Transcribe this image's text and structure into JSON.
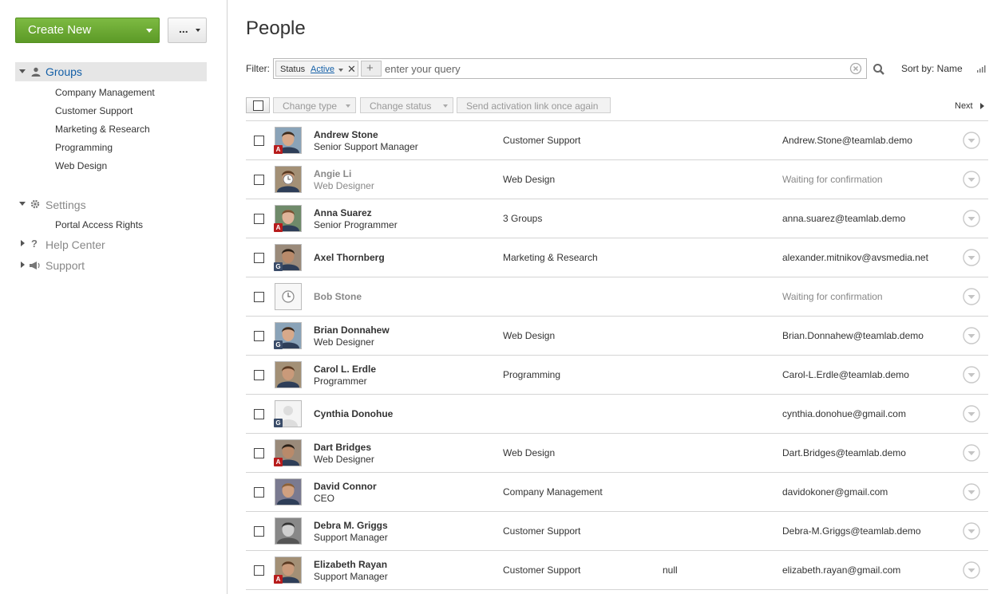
{
  "sidebar": {
    "create_label": "Create New",
    "more_label": "...",
    "groups_label": "Groups",
    "group_items": [
      "Company Management",
      "Customer Support",
      "Marketing & Research",
      "Programming",
      "Web Design"
    ],
    "settings_label": "Settings",
    "settings_items": [
      "Portal Access Rights"
    ],
    "help_label": "Help Center",
    "support_label": "Support"
  },
  "header": {
    "title": "People"
  },
  "filter": {
    "label": "Filter:",
    "chip_name": "Status",
    "chip_value": "Active",
    "chip_remove": "✕",
    "add_symbol": "+",
    "placeholder": "enter your query",
    "sort_label": "Sort by: Name"
  },
  "toolbar": {
    "change_type": "Change type",
    "change_status": "Change status",
    "send_activation": "Send activation link once again",
    "next": "Next"
  },
  "colors": {
    "accent_green": "#6aaa33",
    "link_blue": "#135fa7",
    "admin_badge": "#b71c1c",
    "guest_badge": "#3a4c69"
  },
  "people": [
    {
      "name": "Andrew Stone",
      "title": "Senior Support Manager",
      "dept": "Customer Support",
      "extra": "",
      "email": "Andrew.Stone@teamlab.demo",
      "badge": "A",
      "pending": false,
      "avatar": "photo"
    },
    {
      "name": "Angie Li",
      "title": "Web Designer",
      "dept": "Web Design",
      "extra": "",
      "email": "Waiting for confirmation",
      "badge": "",
      "pending": true,
      "avatar": "photo-clock"
    },
    {
      "name": "Anna Suarez",
      "title": "Senior Programmer",
      "dept": "3 Groups",
      "extra": "",
      "email": "anna.suarez@teamlab.demo",
      "badge": "A",
      "pending": false,
      "avatar": "photo"
    },
    {
      "name": "Axel Thornberg",
      "title": "",
      "dept": "Marketing & Research",
      "extra": "",
      "email": "alexander.mitnikov@avsmedia.net",
      "badge": "G",
      "pending": false,
      "avatar": "photo"
    },
    {
      "name": "Bob Stone",
      "title": "",
      "dept": "",
      "extra": "",
      "email": "Waiting for confirmation",
      "badge": "",
      "pending": true,
      "avatar": "clock"
    },
    {
      "name": "Brian Donnahew",
      "title": "Web Designer",
      "dept": "Web Design",
      "extra": "",
      "email": "Brian.Donnahew@teamlab.demo",
      "badge": "G",
      "pending": false,
      "avatar": "photo"
    },
    {
      "name": "Carol L. Erdle",
      "title": "Programmer",
      "dept": "Programming",
      "extra": "",
      "email": "Carol-L.Erdle@teamlab.demo",
      "badge": "",
      "pending": false,
      "avatar": "photo"
    },
    {
      "name": "Cynthia Donohue",
      "title": "",
      "dept": "",
      "extra": "",
      "email": "cynthia.donohue@gmail.com",
      "badge": "G",
      "pending": false,
      "avatar": "blank"
    },
    {
      "name": "Dart Bridges",
      "title": "Web Designer",
      "dept": "Web Design",
      "extra": "",
      "email": "Dart.Bridges@teamlab.demo",
      "badge": "A",
      "pending": false,
      "avatar": "photo"
    },
    {
      "name": "David Connor",
      "title": "CEO",
      "dept": "Company Management",
      "extra": "",
      "email": "davidokoner@gmail.com",
      "badge": "",
      "pending": false,
      "avatar": "photo"
    },
    {
      "name": "Debra M. Griggs",
      "title": "Support Manager",
      "dept": "Customer Support",
      "extra": "",
      "email": "Debra-M.Griggs@teamlab.demo",
      "badge": "",
      "pending": false,
      "avatar": "photo-bw"
    },
    {
      "name": "Elizabeth Rayan",
      "title": "Support Manager",
      "dept": "Customer Support",
      "extra": "null",
      "email": "elizabeth.rayan@gmail.com",
      "badge": "A",
      "pending": false,
      "avatar": "photo"
    }
  ]
}
